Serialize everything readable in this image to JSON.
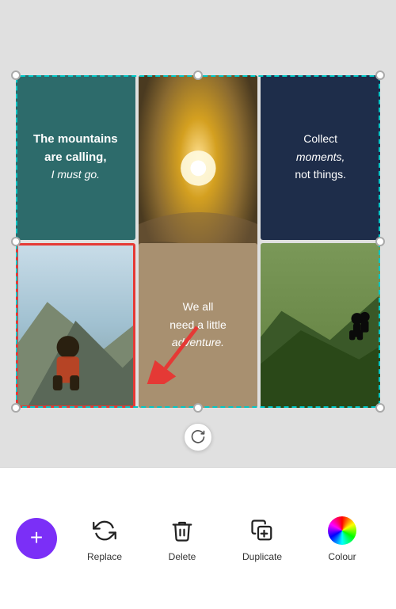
{
  "collage": {
    "cells": [
      {
        "id": "cell-1",
        "type": "text",
        "bg": "#2d6b6b",
        "text_line1": "The mountains",
        "text_line2": "are calling,",
        "text_line3": "I must go."
      },
      {
        "id": "cell-2",
        "type": "photo",
        "photo": "legs-mountain",
        "span": "tall"
      },
      {
        "id": "cell-3",
        "type": "text",
        "bg": "#1e2d4a",
        "text_line1": "Collect",
        "text_line2": "moments,",
        "text_line3": "not things."
      },
      {
        "id": "cell-4",
        "type": "photo",
        "photo": "person-mountain",
        "selected": true
      },
      {
        "id": "cell-5",
        "type": "text",
        "bg": "#a89070",
        "text_line1": "We all",
        "text_line2": "need a little",
        "text_line3": "adventure."
      },
      {
        "id": "cell-6",
        "type": "photo",
        "photo": "mountain-ridge"
      }
    ]
  },
  "toolbar": {
    "add_label": "+",
    "replace_label": "Replace",
    "delete_label": "Delete",
    "duplicate_label": "Duplicate",
    "colour_label": "Colour"
  }
}
